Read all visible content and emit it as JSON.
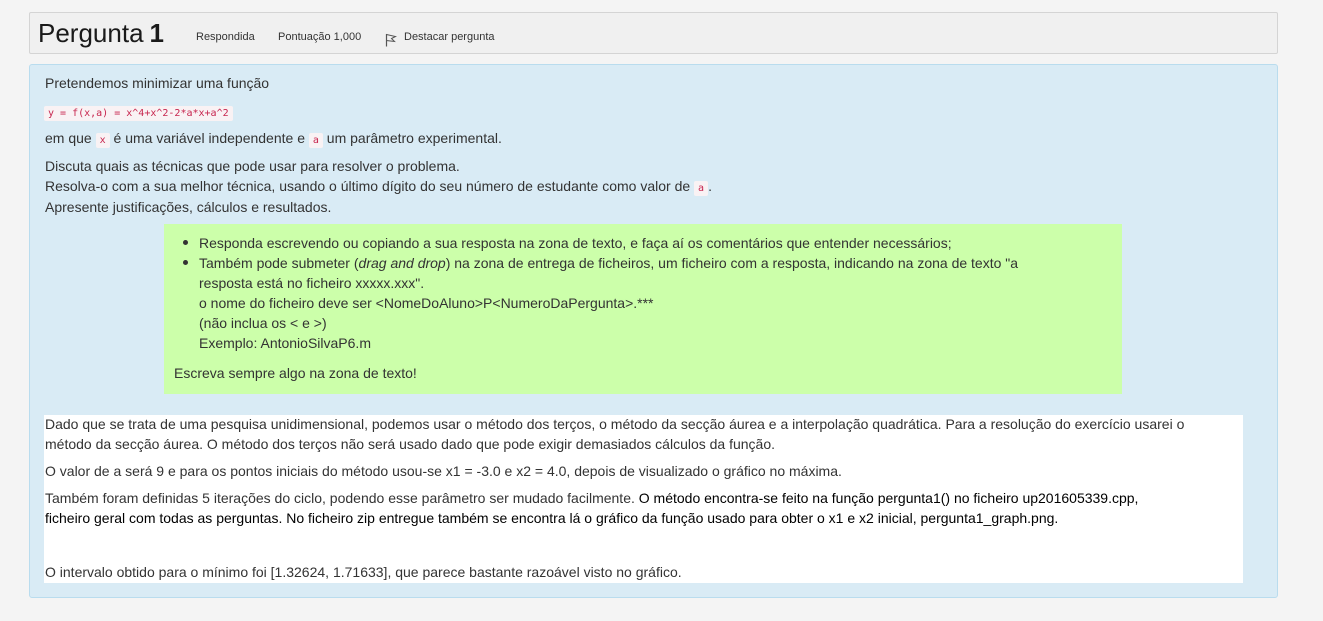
{
  "question": {
    "title_word": "Pergunta",
    "number": "1",
    "status": "Respondida",
    "grade": "Pontuação 1,000",
    "flag_label": "Destacar pergunta"
  },
  "statement": {
    "intro": "Pretendemos minimizar uma função",
    "formula": "y = f(x,a) = x^4+x^2-2*a*x+a^2",
    "line2_pre": "em que",
    "var_x": "x",
    "line2_mid": "é uma variável independente e",
    "var_a": "a",
    "line2_post": "um parâmetro experimental.",
    "line3": "Discuta quais as técnicas que pode usar para resolver o problema.",
    "line4_pre": "Resolva-o com a sua melhor técnica, usando o último dígito do seu número de estudante como valor de",
    "line4_var": "a",
    "line4_post": ".",
    "line5": "Apresente justificações, cálculos e resultados."
  },
  "instructions": {
    "bullet1": "Responda escrevendo ou copiando a sua resposta na zona de texto, e faça aí os comentários que entender necessários;",
    "bullet2_pre": "Também pode submeter (",
    "bullet2_em": "drag and drop",
    "bullet2_post": ") na zona de entrega de ficheiros, um ficheiro com a resposta, indicando na zona de texto \"a",
    "bullet2_l2": "resposta está no ficheiro xxxxx.xxx\".",
    "bullet2_l3": "o nome do ficheiro deve ser <NomeDoAluno>P<NumeroDaPergunta>.***",
    "bullet2_l4": "(não inclua os < e >)",
    "bullet2_l5": "Exemplo: AntonioSilvaP6.m",
    "footer": "Escreva sempre algo na zona de texto!"
  },
  "answer": {
    "p1_l1": "Dado que se trata de uma pesquisa unidimensional,  podemos usar o método dos terços, o método da secção áurea e a interpolação quadrática. Para a resolução do exercício usarei o",
    "p1_l2": "método da secção áurea. O método dos terços não será usado dado que pode exigir demasiados cálculos da função.",
    "p2": "O valor de a será 9 e para os pontos iniciais do método usou-se x1 = -3.0 e x2 = 4.0, depois de visualizado o gráfico no máxima.",
    "p3_normal": "Também foram definidas 5 iterações do ciclo, podendo esse parâmetro ser mudado facilmente. ",
    "p3_bold_l1": "O método encontra-se feito na função pergunta1() no ficheiro up201605339.cpp,",
    "p3_bold_l2": "ficheiro geral com todas as perguntas. No ficheiro zip entregue também se encontra lá o gráfico da função usado para obter o x1 e x2 inicial, pergunta1_graph.png.",
    "p4": "O intervalo obtido para o mínimo foi [1.32624, 1.71633], que parece bastante razoável visto no gráfico."
  }
}
